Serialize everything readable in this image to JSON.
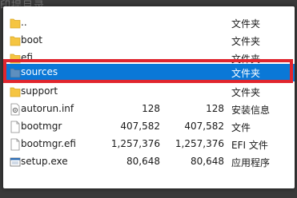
{
  "background_title": "印提目录",
  "files": [
    {
      "name": "..",
      "size": "",
      "packed": "",
      "type": "文件夹",
      "icon": "folder-icon"
    },
    {
      "name": "boot",
      "size": "",
      "packed": "",
      "type": "文件夹",
      "icon": "folder-icon"
    },
    {
      "name": "efi",
      "size": "",
      "packed": "",
      "type": "文件夹",
      "icon": "folder-icon"
    },
    {
      "name": "sources",
      "size": "",
      "packed": "",
      "type": "文件夹",
      "icon": "folder-icon",
      "selected": true
    },
    {
      "name": "support",
      "size": "",
      "packed": "",
      "type": "文件夹",
      "icon": "folder-icon"
    },
    {
      "name": "autorun.inf",
      "size": "128",
      "packed": "128",
      "type": "安装信息",
      "icon": "settings-file-icon"
    },
    {
      "name": "bootmgr",
      "size": "407,582",
      "packed": "407,582",
      "type": "文件",
      "icon": "file-icon"
    },
    {
      "name": "bootmgr.efi",
      "size": "1,257,376",
      "packed": "1,257,376",
      "type": "EFI 文件",
      "icon": "file-icon"
    },
    {
      "name": "setup.exe",
      "size": "80,648",
      "packed": "80,648",
      "type": "应用程序",
      "icon": "application-icon"
    }
  ],
  "colors": {
    "selection": "#0a78d7",
    "highlight_frame": "#e0262e",
    "folder": "#f5c542"
  }
}
